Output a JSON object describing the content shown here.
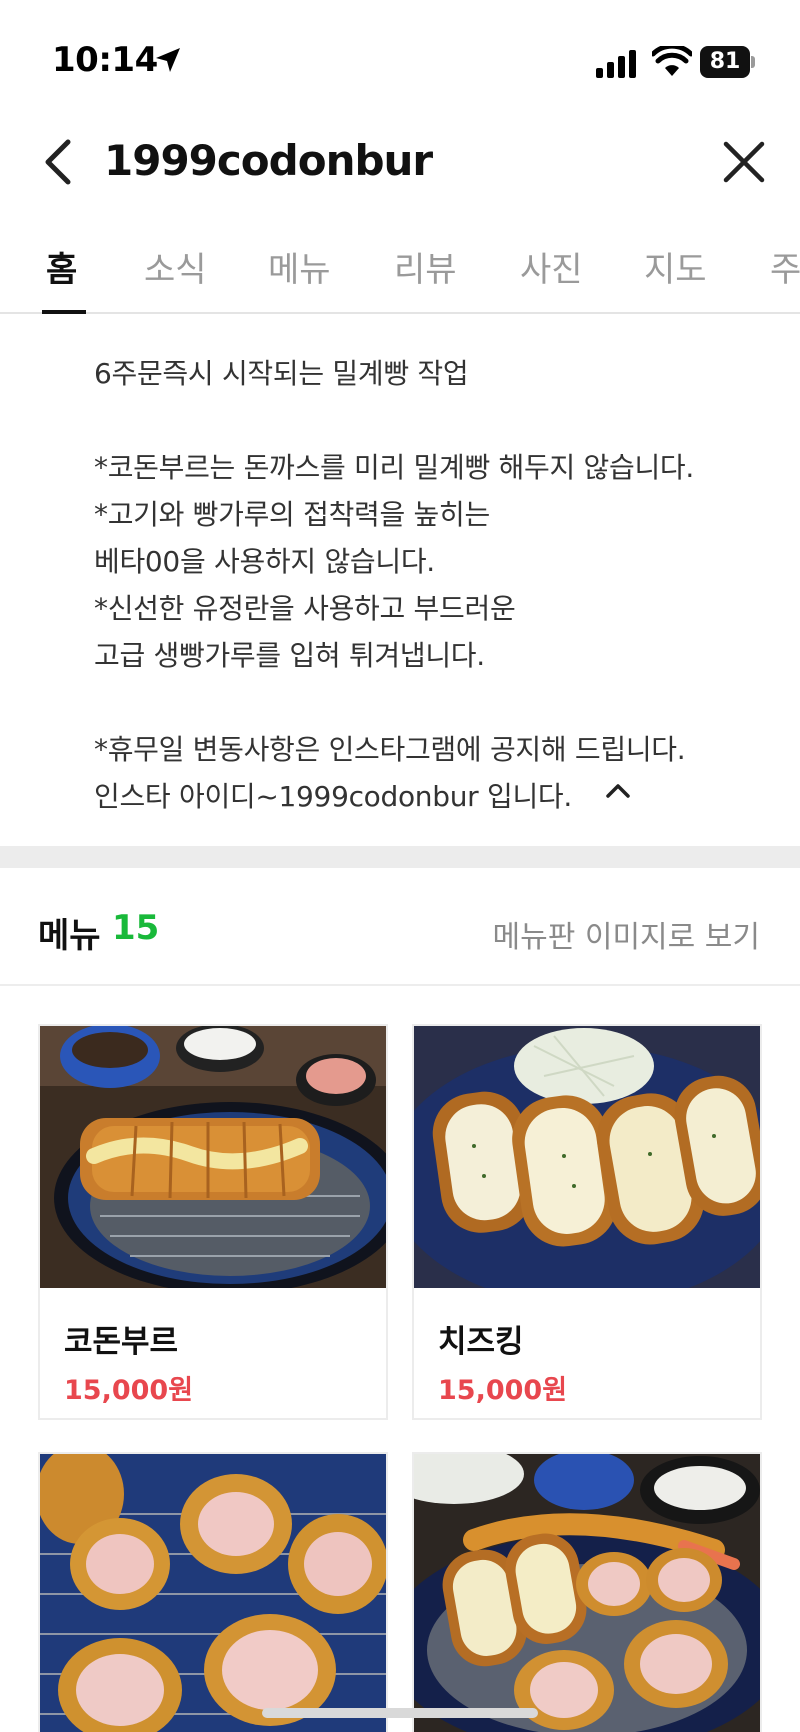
{
  "status_bar": {
    "time": "10:14",
    "battery": "81",
    "icons": [
      "location-arrow-icon",
      "cellular-signal-icon",
      "wifi-icon",
      "battery-icon"
    ]
  },
  "header": {
    "title": "1999codonbur",
    "back_icon": "chevron-left-icon",
    "close_icon": "close-icon"
  },
  "tabs": [
    {
      "label": "홈",
      "active": true
    },
    {
      "label": "소식",
      "active": false
    },
    {
      "label": "메뉴",
      "active": false
    },
    {
      "label": "리뷰",
      "active": false
    },
    {
      "label": "사진",
      "active": false
    },
    {
      "label": "지도",
      "active": false
    },
    {
      "label": "주",
      "active": false
    }
  ],
  "description": {
    "lines": [
      "6주문즉시 시작되는 밀계빵 작업",
      "",
      "*코돈부르는 돈까스를 미리 밀계빵 해두지 않습니다.",
      "*고기와 빵가루의 접착력을 높히는",
      "베타00을 사용하지 않습니다.",
      "*신선한 유정란을 사용하고 부드러운",
      "고급 생빵가루를 입혀 튀겨냅니다.",
      "",
      "*휴무일 변동사항은 인스타그램에 공지해 드립니다.",
      "인스타 아이디~1999codonbur 입니다."
    ],
    "collapse_icon": "chevron-up-icon"
  },
  "menu": {
    "title": "메뉴",
    "count": "15",
    "image_link": "메뉴판 이미지로 보기",
    "items": [
      {
        "name": "코돈부르",
        "price": "15,000원"
      },
      {
        "name": "치즈킹",
        "price": "15,000원"
      },
      {
        "name": "",
        "price": ""
      },
      {
        "name": "",
        "price": ""
      }
    ]
  },
  "colors": {
    "accent_green": "#19b93a",
    "price_red": "#e8474e",
    "tab_inactive": "#9a9a9a"
  }
}
